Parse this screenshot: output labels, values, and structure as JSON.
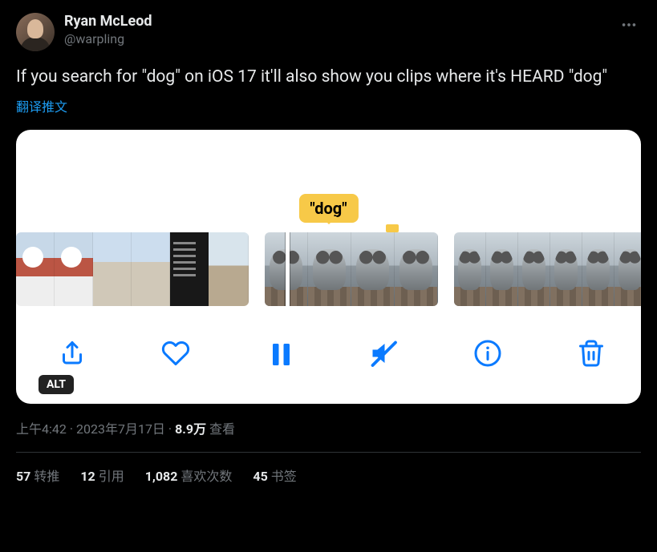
{
  "author": {
    "display_name": "Ryan McLeod",
    "handle": "@warpling"
  },
  "tweet": {
    "text": "If you search for \"dog\" on iOS 17 it'll also show you clips where it's HEARD \"dog\"",
    "translate_label": "翻译推文"
  },
  "media": {
    "tag_text": "\"dog\"",
    "alt_badge": "ALT"
  },
  "meta": {
    "time": "上午4:42",
    "date": "2023年7月17日",
    "separator": " · ",
    "views_count": "8.9万",
    "views_label": " 查看"
  },
  "engagement": {
    "retweets": {
      "count": "57",
      "label": "转推"
    },
    "quotes": {
      "count": "12",
      "label": "引用"
    },
    "likes": {
      "count": "1,082",
      "label": "喜欢次数"
    },
    "bookmarks": {
      "count": "45",
      "label": "书签"
    }
  }
}
